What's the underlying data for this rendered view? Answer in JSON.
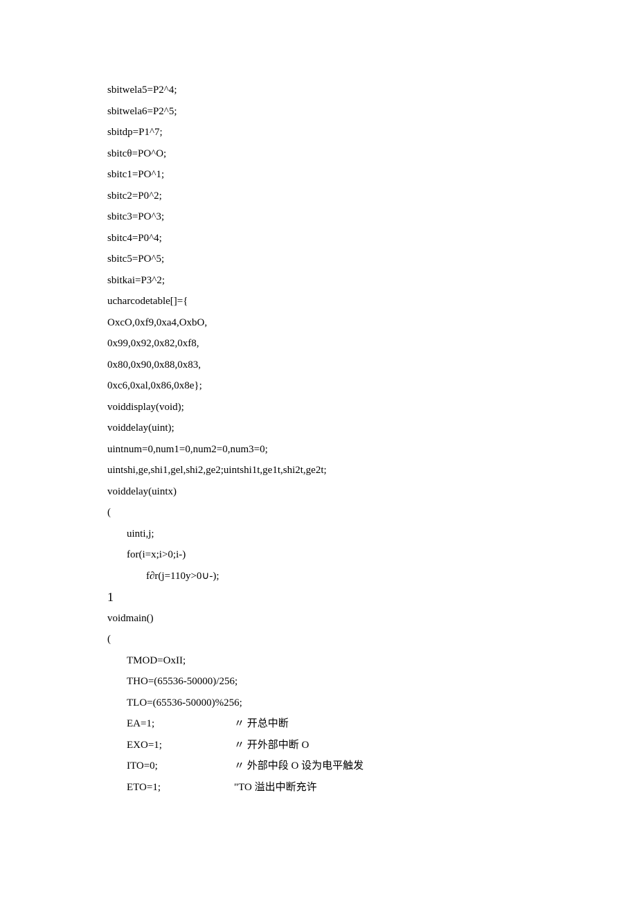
{
  "lines": [
    {
      "text": "sbitwela5=P2^4;",
      "indent": 0
    },
    {
      "text": "sbitwela6=P2^5;",
      "indent": 0
    },
    {
      "text": "sbitdp=P1^7;",
      "indent": 0
    },
    {
      "text": "sbitcθ=PO^O;",
      "indent": 0
    },
    {
      "text": "sbitc1=PO^1;",
      "indent": 0
    },
    {
      "text": "sbitc2=P0^2;",
      "indent": 0
    },
    {
      "text": "sbitc3=PO^3;",
      "indent": 0
    },
    {
      "text": "sbitc4=P0^4;",
      "indent": 0
    },
    {
      "text": "sbitc5=PO^5;",
      "indent": 0
    },
    {
      "text": "sbitkai=P3^2;",
      "indent": 0
    },
    {
      "text": "ucharcodetable[]={",
      "indent": 0
    },
    {
      "text": "OxcO,0xf9,0xa4,OxbO,",
      "indent": 0
    },
    {
      "text": "0x99,0x92,0x82,0xf8,",
      "indent": 0
    },
    {
      "text": "0x80,0x90,0x88,0x83,",
      "indent": 0
    },
    {
      "text": "0xc6,0xal,0x86,0x8e};",
      "indent": 0
    },
    {
      "text": "voiddisplay(void);",
      "indent": 0
    },
    {
      "text": "voiddelay(uint);",
      "indent": 0
    },
    {
      "text": "uintnum=0,num1=0,num2=0,num3=0;",
      "indent": 0
    },
    {
      "text": "uintshi,ge,shi1,gel,shi2,ge2;uintshi1t,ge1t,shi2t,ge2t;",
      "indent": 0
    },
    {
      "text": "voiddelay(uintx)",
      "indent": 0
    },
    {
      "text": "(",
      "indent": 0
    },
    {
      "text": "uinti,j;",
      "indent": 1
    },
    {
      "text": "for(i=x;i>0;i-)",
      "indent": 1
    },
    {
      "text": "f∂r(j=110y>0∪-);",
      "indent": 2
    },
    {
      "text": "1",
      "indent": 0,
      "brace": true
    },
    {
      "text": "voidmain()",
      "indent": 0
    },
    {
      "text": "(",
      "indent": 0
    },
    {
      "text": "TMOD=OxII;",
      "indent": 1
    },
    {
      "text": "THO=(65536-50000)/256;",
      "indent": 1
    },
    {
      "text": "TLO=(65536-50000)%256;",
      "indent": 1
    },
    {
      "code": "EA=1;",
      "comment": "〃 开总中断",
      "indent": 1,
      "hasComment": true
    },
    {
      "code": "EXO=1;",
      "comment": "〃 开外部中断 O",
      "indent": 1,
      "hasComment": true
    },
    {
      "code": "ITO=0;",
      "comment": "〃 外部中段 O 设为电平触发",
      "indent": 1,
      "hasComment": true
    },
    {
      "code": "ETO=1;",
      "comment": "\"TO 溢出中断充许",
      "indent": 1,
      "hasComment": true
    }
  ]
}
